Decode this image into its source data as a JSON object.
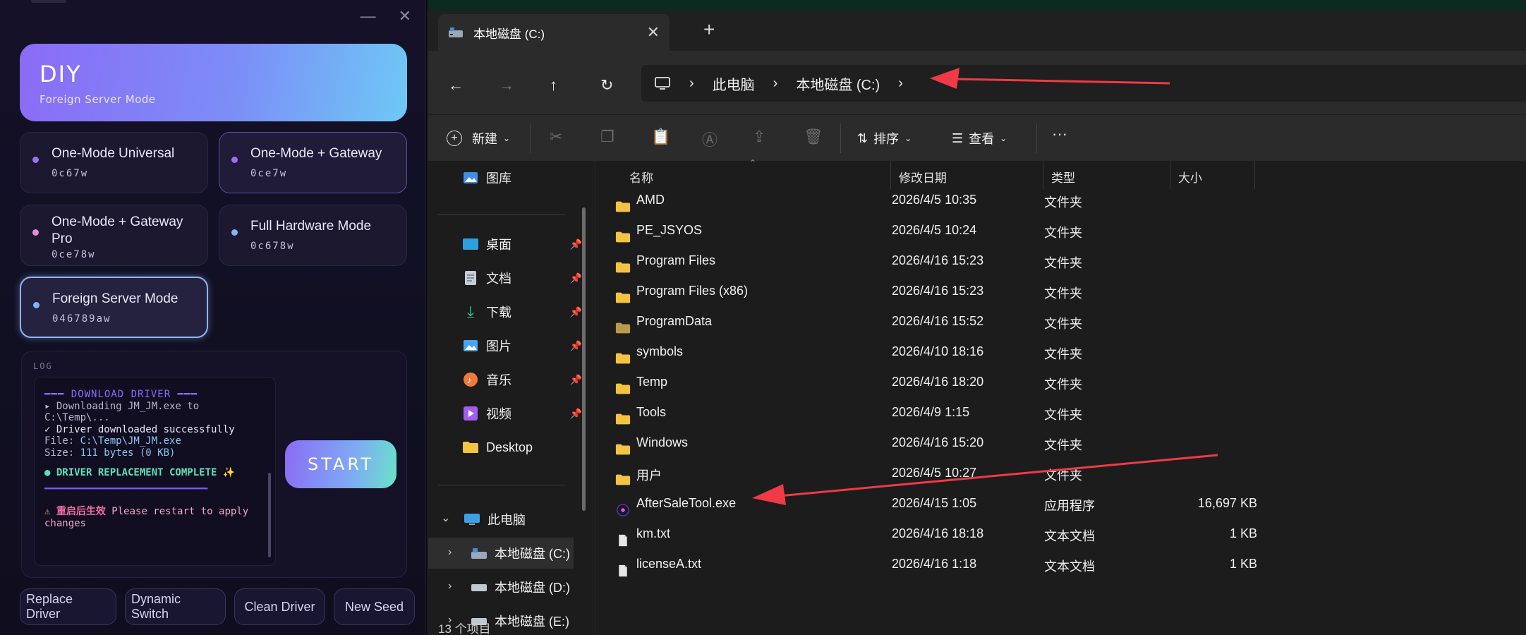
{
  "diy": {
    "title": "DIY",
    "subtitle": "Foreign Server Mode",
    "modes": [
      {
        "name": "One-Mode Universal",
        "code": "0c67w",
        "dot": "#a26cf2"
      },
      {
        "name": "One-Mode + Gateway",
        "code": "0ce7w",
        "dot": "#a26cf2"
      },
      {
        "name": "One-Mode + Gateway Pro",
        "code": "0ce78w",
        "dot": "#e58ad9"
      },
      {
        "name": "Full Hardware Mode",
        "code": "0c678w",
        "dot": "#7fb4f5"
      },
      {
        "name": "Foreign Server Mode",
        "code": "046789aw",
        "dot": "#7fb4f5"
      }
    ],
    "log_label": "LOG",
    "log": {
      "header": "━━━ DOWNLOAD DRIVER ━━━",
      "line1": "▸ Downloading JM_JM.exe to C:\\Temp\\...",
      "line2": "✓ Driver downloaded successfully",
      "line3_label": "File: ",
      "line3_value": "C:\\Temp\\JM_JM.exe",
      "line4_label": "Size: ",
      "line4_value": "111 bytes (0 KB)",
      "complete": "● DRIVER REPLACEMENT COMPLETE ✨",
      "bar": "━━━━━━━━━━━━━━━━━━━━━━━━━━━━━━━",
      "warn_icon": "⚠",
      "warn_bold": "重启后生效",
      "warn_text": " Please restart to apply changes"
    },
    "start_label": "START",
    "actions": [
      "Replace Driver",
      "Dynamic Switch",
      "Clean Driver",
      "New Seed"
    ]
  },
  "explorer": {
    "tab_title": "本地磁盘 (C:)",
    "address": [
      "此电脑",
      "本地磁盘 (C:)"
    ],
    "toolbar": {
      "new_label": "新建",
      "sort_label": "排序",
      "view_label": "查看",
      "more": "···"
    },
    "nav": {
      "gallery": "图库",
      "quick": [
        {
          "label": "桌面",
          "icon": "desktop-icon",
          "color": "#2f9fe0"
        },
        {
          "label": "文档",
          "icon": "document-icon",
          "color": "#8fa3b8"
        },
        {
          "label": "下载",
          "icon": "download-icon",
          "color": "#3ad59a"
        },
        {
          "label": "图片",
          "icon": "pictures-icon",
          "color": "#4aa3f0"
        },
        {
          "label": "音乐",
          "icon": "music-icon",
          "color": "#f07a3c"
        },
        {
          "label": "视频",
          "icon": "video-icon",
          "color": "#a25cf0"
        },
        {
          "label": "Desktop",
          "icon": "folder-icon",
          "color": "#f5c342"
        }
      ],
      "this_pc": "此电脑",
      "drives": [
        "本地磁盘 (C:)",
        "本地磁盘 (D:)",
        "本地磁盘 (E:)"
      ]
    },
    "columns": {
      "name": "名称",
      "date": "修改日期",
      "type": "类型",
      "size": "大小"
    },
    "files": [
      {
        "name": "AMD",
        "date": "2026/4/5 10:35",
        "type": "文件夹",
        "size": "",
        "kind": "folder"
      },
      {
        "name": "PE_JSYOS",
        "date": "2026/4/5 10:24",
        "type": "文件夹",
        "size": "",
        "kind": "folder"
      },
      {
        "name": "Program Files",
        "date": "2026/4/16 15:23",
        "type": "文件夹",
        "size": "",
        "kind": "folder"
      },
      {
        "name": "Program Files (x86)",
        "date": "2026/4/16 15:23",
        "type": "文件夹",
        "size": "",
        "kind": "folder"
      },
      {
        "name": "ProgramData",
        "date": "2026/4/16 15:52",
        "type": "文件夹",
        "size": "",
        "kind": "folder-dim"
      },
      {
        "name": "symbols",
        "date": "2026/4/10 18:16",
        "type": "文件夹",
        "size": "",
        "kind": "folder"
      },
      {
        "name": "Temp",
        "date": "2026/4/16 18:20",
        "type": "文件夹",
        "size": "",
        "kind": "folder"
      },
      {
        "name": "Tools",
        "date": "2026/4/9 1:15",
        "type": "文件夹",
        "size": "",
        "kind": "folder"
      },
      {
        "name": "Windows",
        "date": "2026/4/16 15:20",
        "type": "文件夹",
        "size": "",
        "kind": "folder"
      },
      {
        "name": "用户",
        "date": "2026/4/5 10:27",
        "type": "文件夹",
        "size": "",
        "kind": "folder"
      },
      {
        "name": "AfterSaleTool.exe",
        "date": "2026/4/15 1:05",
        "type": "应用程序",
        "size": "16,697 KB",
        "kind": "app"
      },
      {
        "name": "km.txt",
        "date": "2026/4/16 18:18",
        "type": "文本文档",
        "size": "1 KB",
        "kind": "text"
      },
      {
        "name": "licenseA.txt",
        "date": "2026/4/16 1:18",
        "type": "文本文档",
        "size": "1 KB",
        "kind": "text"
      }
    ],
    "status": "13 个项目"
  },
  "colors": {
    "accent_purple": "#8b6bf5",
    "accent_cyan": "#6ec8f6",
    "annotation_red": "#f03a47",
    "folder": "#f5c342"
  }
}
